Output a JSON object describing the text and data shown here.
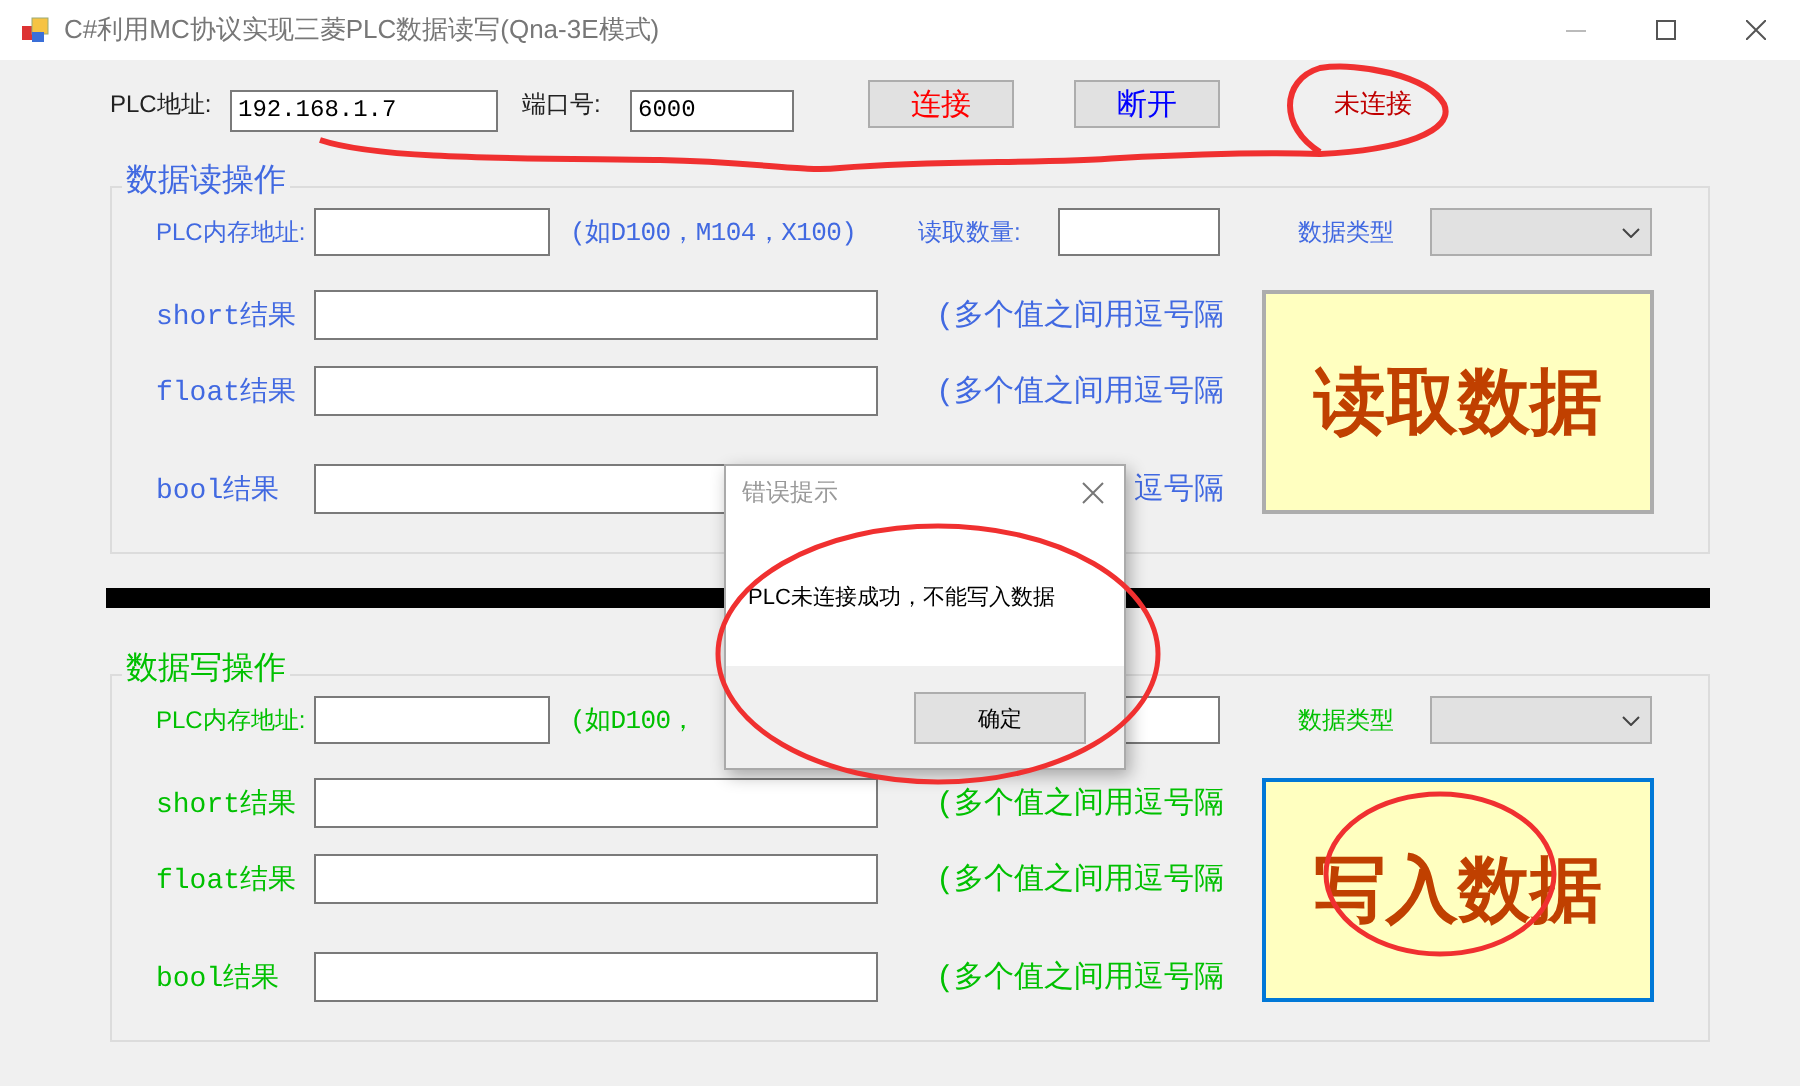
{
  "window": {
    "title": "C#利用MC协议实现三菱PLC数据读写(Qna-3E模式)"
  },
  "connection": {
    "ip_label": "PLC地址:",
    "ip_value": "192.168.1.7",
    "port_label": "端口号:",
    "port_value": "6000",
    "status": "未连接",
    "buttons": [
      {
        "label": "连接",
        "color": "#ff0000"
      },
      {
        "label": "断开",
        "color": "#0000ff"
      }
    ]
  },
  "sections": [
    {
      "title": "数据读操作",
      "color": "#4169e1",
      "address_label": "PLC内存地址:",
      "address_hint": "(如D100，M104，X100)",
      "count_label": "读取数量:",
      "type_label": "数据类型",
      "action": "读取数据",
      "focused": false,
      "results": [
        {
          "label": "short结果",
          "hint": "(多个值之间用逗号隔"
        },
        {
          "label": "float结果",
          "hint": "(多个值之间用逗号隔"
        },
        {
          "label": "bool结果",
          "hint": "逗号隔"
        }
      ]
    },
    {
      "title": "数据写操作",
      "color": "#00c000",
      "address_label": "PLC内存地址:",
      "address_hint": "(如D100，",
      "type_label": "数据类型",
      "action": "写入数据",
      "focused": true,
      "results": [
        {
          "label": "short结果",
          "hint": "(多个值之间用逗号隔"
        },
        {
          "label": "float结果",
          "hint": "(多个值之间用逗号隔"
        },
        {
          "label": "bool结果",
          "hint": "(多个值之间用逗号隔"
        }
      ]
    }
  ],
  "dialog": {
    "title": "错误提示",
    "message": "PLC未连接成功，不能写入数据",
    "button": "确定"
  }
}
